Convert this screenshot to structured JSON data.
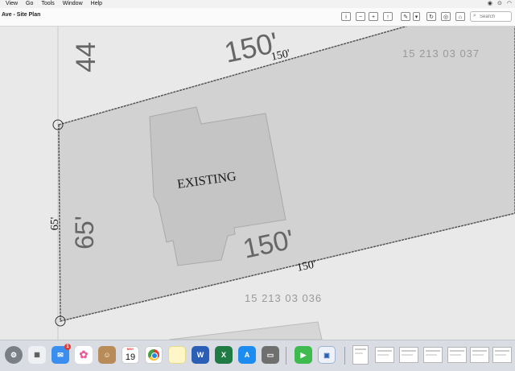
{
  "menubar": {
    "items": [
      "View",
      "Go",
      "Tools",
      "Window",
      "Help"
    ],
    "status_icons": [
      "control-center-icon",
      "record-icon",
      "wifi-icon"
    ]
  },
  "toolbar": {
    "title": "Ave - Site Plan",
    "search_placeholder": "Search",
    "buttons": [
      "info-icon",
      "zoom-out-icon",
      "zoom-in-icon",
      "share-icon",
      "markup-icon",
      "chevron-down-icon",
      "rotate-icon",
      "highlight-icon"
    ]
  },
  "document": {
    "top_partial_number": "44",
    "top_dimension_large": "150'",
    "top_dimension_small": "150'",
    "top_parcel_id": "15 213 03 037",
    "building_label": "EXISTING",
    "left_dimension_large": "65'",
    "left_dimension_small": "65'",
    "bottom_dimension_large": "150'",
    "bottom_dimension_small": "150'",
    "bottom_parcel_id": "15 213 03 036"
  },
  "dock": {
    "apps": [
      "System Settings",
      "Launchpad",
      "Mail",
      "Photos",
      "Contacts",
      "Calendar",
      "Chrome",
      "Notes",
      "Word",
      "Excel",
      "App Store",
      "Printer",
      "FaceTime",
      "Preview"
    ],
    "mail_badge": "1",
    "calendar_month": "MAY",
    "calendar_day": "19"
  }
}
